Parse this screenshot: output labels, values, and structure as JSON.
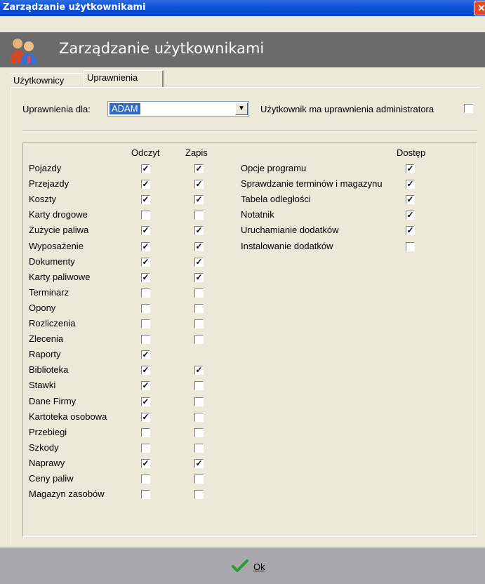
{
  "window": {
    "title": "Zarządzanie użytkownikami",
    "close_label": "✕"
  },
  "header": {
    "title": "Zarządzanie użytkownikami",
    "icon": "users-icon"
  },
  "tabs": [
    {
      "label": "Użytkownicy",
      "active": false
    },
    {
      "label": "Uprawnienia",
      "active": true
    }
  ],
  "permissions_for": {
    "label": "Uprawnienia dla:",
    "value": "ADAM"
  },
  "admin": {
    "label": "Użytkownik ma uprawnienia administratora",
    "checked": false
  },
  "columns": {
    "read": "Odczyt",
    "write": "Zapis",
    "access": "Dostęp"
  },
  "modules": [
    {
      "name": "Pojazdy",
      "read": true,
      "write": true
    },
    {
      "name": "Przejazdy",
      "read": true,
      "write": true
    },
    {
      "name": "Koszty",
      "read": true,
      "write": true
    },
    {
      "name": "Karty drogowe",
      "read": false,
      "write": false
    },
    {
      "name": "Zużycie paliwa",
      "read": true,
      "write": true
    },
    {
      "name": "Wyposażenie",
      "read": true,
      "write": true
    },
    {
      "name": "Dokumenty",
      "read": true,
      "write": true
    },
    {
      "name": "Karty paliwowe",
      "read": true,
      "write": true
    },
    {
      "name": "Terminarz",
      "read": false,
      "write": false
    },
    {
      "name": "Opony",
      "read": false,
      "write": false
    },
    {
      "name": "Rozliczenia",
      "read": false,
      "write": false
    },
    {
      "name": "Zlecenia",
      "read": false,
      "write": false
    },
    {
      "name": "Raporty",
      "read": true,
      "write": null
    },
    {
      "name": "Biblioteka",
      "read": true,
      "write": true
    },
    {
      "name": "Stawki",
      "read": true,
      "write": false
    },
    {
      "name": "Dane Firmy",
      "read": true,
      "write": false
    },
    {
      "name": "Kartoteka osobowa",
      "read": true,
      "write": false
    },
    {
      "name": "Przebiegi",
      "read": false,
      "write": false
    },
    {
      "name": "Szkody",
      "read": false,
      "write": false
    },
    {
      "name": "Naprawy",
      "read": true,
      "write": true
    },
    {
      "name": "Ceny paliw",
      "read": false,
      "write": false
    },
    {
      "name": "Magazyn zasobów",
      "read": false,
      "write": false
    }
  ],
  "access": [
    {
      "name": "Opcje programu",
      "checked": true
    },
    {
      "name": "Sprawdzanie terminów i magazynu",
      "checked": true
    },
    {
      "name": "Tabela odległości",
      "checked": true
    },
    {
      "name": "Notatnik",
      "checked": true
    },
    {
      "name": "Uruchamianie dodatków",
      "checked": true
    },
    {
      "name": "Instalowanie dodatków",
      "checked": false
    }
  ],
  "footer": {
    "ok_label": "Ok",
    "ok_icon": "checkmark-icon"
  }
}
